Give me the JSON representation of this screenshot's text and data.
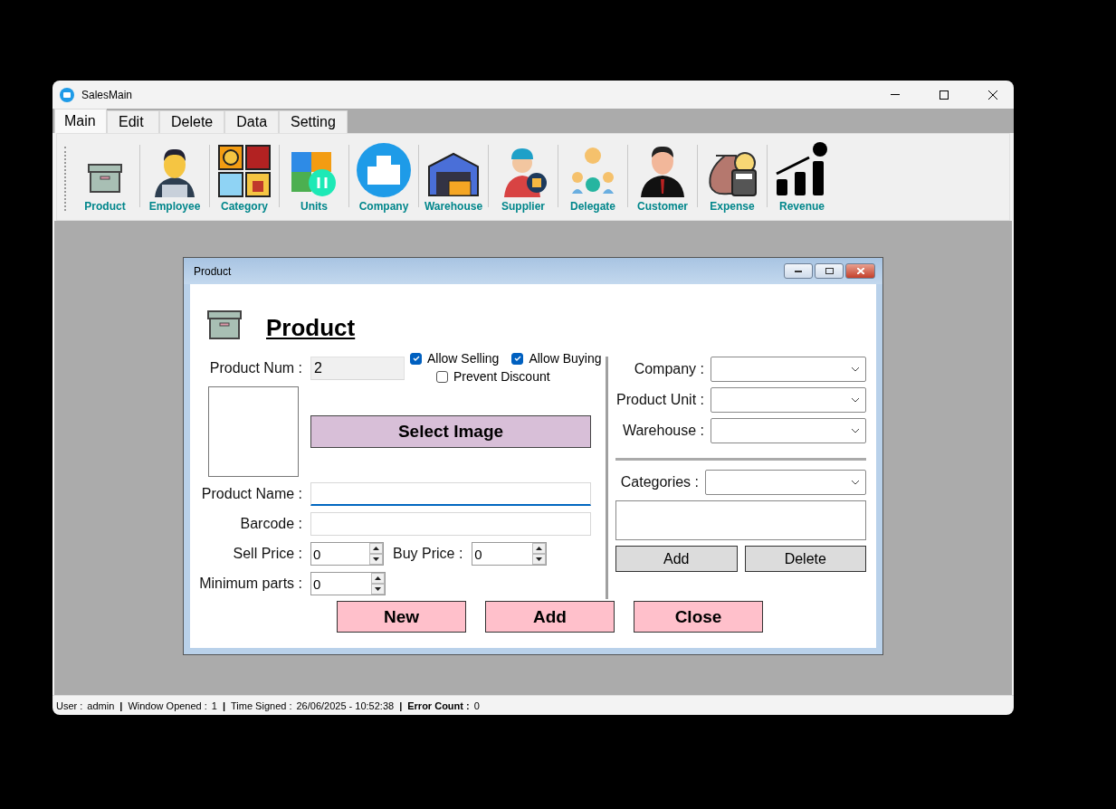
{
  "window": {
    "title": "SalesMain"
  },
  "tabs": [
    {
      "label": "Main",
      "selected": true
    },
    {
      "label": "Edit",
      "selected": false
    },
    {
      "label": "Delete",
      "selected": false
    },
    {
      "label": "Data",
      "selected": false
    },
    {
      "label": "Setting",
      "selected": false
    }
  ],
  "toolbar": [
    {
      "label": "Product"
    },
    {
      "label": "Employee"
    },
    {
      "label": "Category"
    },
    {
      "label": "Units"
    },
    {
      "label": "Company"
    },
    {
      "label": "Warehouse"
    },
    {
      "label": "Supplier"
    },
    {
      "label": "Delegate"
    },
    {
      "label": "Customer"
    },
    {
      "label": "Expense"
    },
    {
      "label": "Revenue"
    }
  ],
  "dialog": {
    "title": "Product",
    "heading": "Product",
    "product_num": {
      "label": "Product Num :",
      "value": "2"
    },
    "checkboxes": [
      {
        "label": "Allow Selling",
        "checked": true
      },
      {
        "label": "Allow Buying",
        "checked": true
      },
      {
        "label": "Prevent Discount",
        "checked": false
      }
    ],
    "select_image": "Select Image",
    "product_name": {
      "label": "Product Name :",
      "focused": true
    },
    "barcode": {
      "label": "Barcode :"
    },
    "sell_price": {
      "label": "Sell Price :",
      "value": "0"
    },
    "buy_price": {
      "label": "Buy Price :",
      "value": "0"
    },
    "minimum_parts": {
      "label": "Minimum parts :",
      "value": "0"
    },
    "combos": [
      {
        "label": "Company :"
      },
      {
        "label": "Product Unit :"
      },
      {
        "label": "Warehouse :"
      }
    ],
    "categories": {
      "label": "Categories :",
      "buttons": [
        "Add",
        "Delete"
      ]
    },
    "buttons": [
      "New",
      "Add",
      "Close"
    ]
  },
  "status_bar": [
    {
      "kind": "field",
      "label": "User :",
      "value": "admin",
      "bold": false
    },
    {
      "kind": "separator",
      "text": "|"
    },
    {
      "kind": "field",
      "label": "Window Opened :",
      "value": "1",
      "bold": false
    },
    {
      "kind": "separator",
      "text": "|"
    },
    {
      "kind": "field",
      "label": "Time Signed :",
      "value": "26/06/2025 - 10:52:38",
      "bold": false
    },
    {
      "kind": "separator",
      "text": "|"
    },
    {
      "kind": "field",
      "label": "Error Count :",
      "value": "0",
      "bold": true
    }
  ]
}
